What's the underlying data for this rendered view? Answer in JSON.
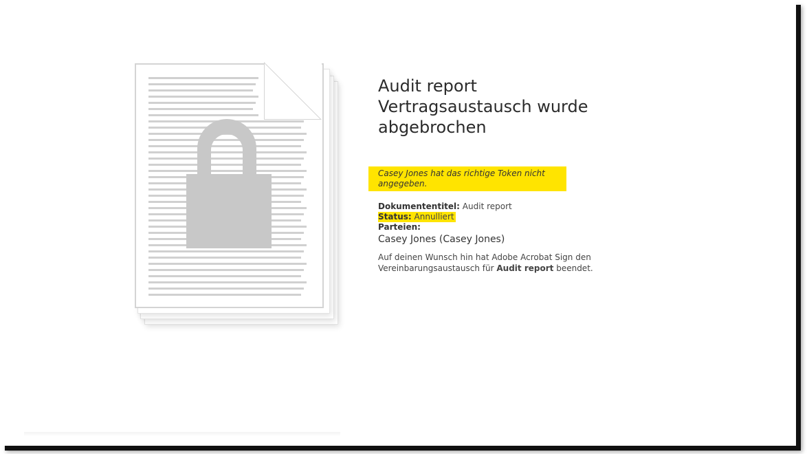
{
  "title": {
    "line1": "Audit report",
    "line2": "Vertragsaustausch wurde",
    "line3": "abgebrochen"
  },
  "notice": "Casey Jones hat das richtige Token nicht angegeben.",
  "meta": {
    "doc_title_label": "Dokumententitel:",
    "doc_title_value": "Audit report",
    "status_label": "Status:",
    "status_value": "Annulliert",
    "parties_label": "Parteien:",
    "party_value": "Casey Jones (Casey Jones)"
  },
  "description": {
    "prefix": "Auf deinen Wunsch hin hat Adobe Acrobat Sign den Vereinbarungsaustausch für",
    "bold": "Audit report",
    "suffix": "beendet."
  },
  "illustration": {
    "icon": "document-lock-icon",
    "lock_color": "#c8c8c8",
    "line_color": "#d0d0d0"
  },
  "colors": {
    "highlight": "#ffe400",
    "text": "#333333"
  }
}
